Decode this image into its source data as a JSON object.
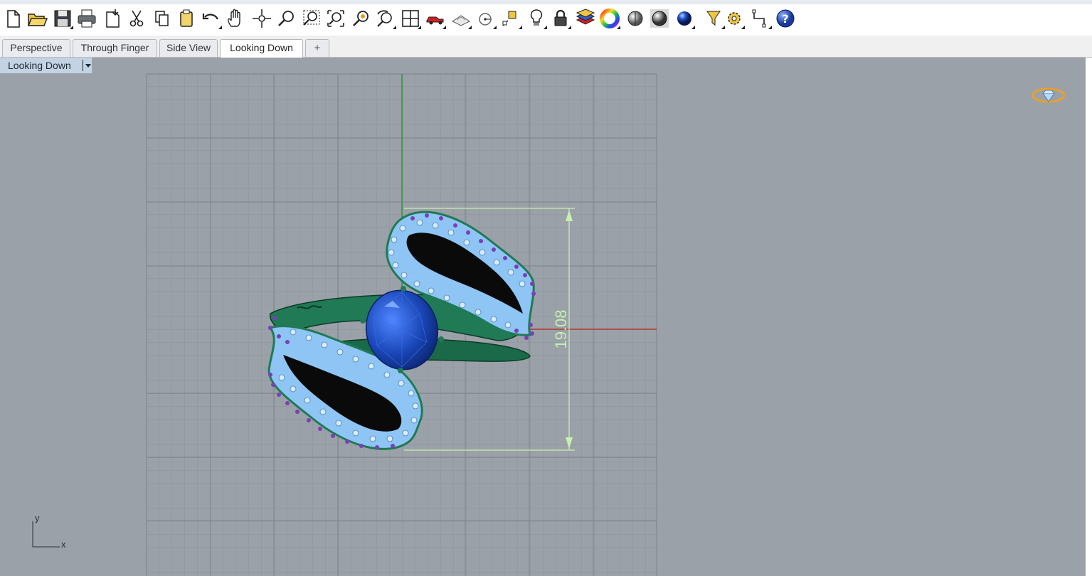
{
  "toolbar": {
    "icons": [
      "new-file-icon",
      "open-folder-icon",
      "save-icon",
      "print-icon",
      "import-icon",
      "cut-icon",
      "copy-icon",
      "paste-icon",
      "undo-icon",
      "pan-hand-icon",
      "rotate-view-icon",
      "zoom-icon",
      "zoom-window-icon",
      "zoom-extents-icon",
      "zoom-selected-icon",
      "undo-view-icon",
      "viewport-layout-icon",
      "car-icon",
      "plane-icon",
      "point-icon",
      "snap-icon",
      "light-bulb-icon",
      "lock-icon",
      "layer-icon",
      "color-wheel-icon",
      "shaded-sphere-icon",
      "rendered-sphere-icon",
      "render-sphere-blue-icon",
      "filter-icon",
      "gear-icon",
      "dimension-icon",
      "help-icon"
    ]
  },
  "tabs": [
    {
      "label": "Perspective",
      "active": false
    },
    {
      "label": "Through Finger",
      "active": false
    },
    {
      "label": "Side View",
      "active": false
    },
    {
      "label": "Looking Down",
      "active": true
    }
  ],
  "tab_add_label": "+",
  "viewport": {
    "label": "Looking Down",
    "dimension_text": "19.08",
    "axis_y": "y",
    "axis_x": "x"
  },
  "colors": {
    "ring_green": "#1f7a55",
    "pave_blue": "#8ec5f5",
    "prong_purple": "#7a3fb8",
    "center_stone": "#1a47b8",
    "dimension_green": "#c8f0b0",
    "axis_red": "#b23a2a",
    "axis_green": "#2e9a3a"
  }
}
